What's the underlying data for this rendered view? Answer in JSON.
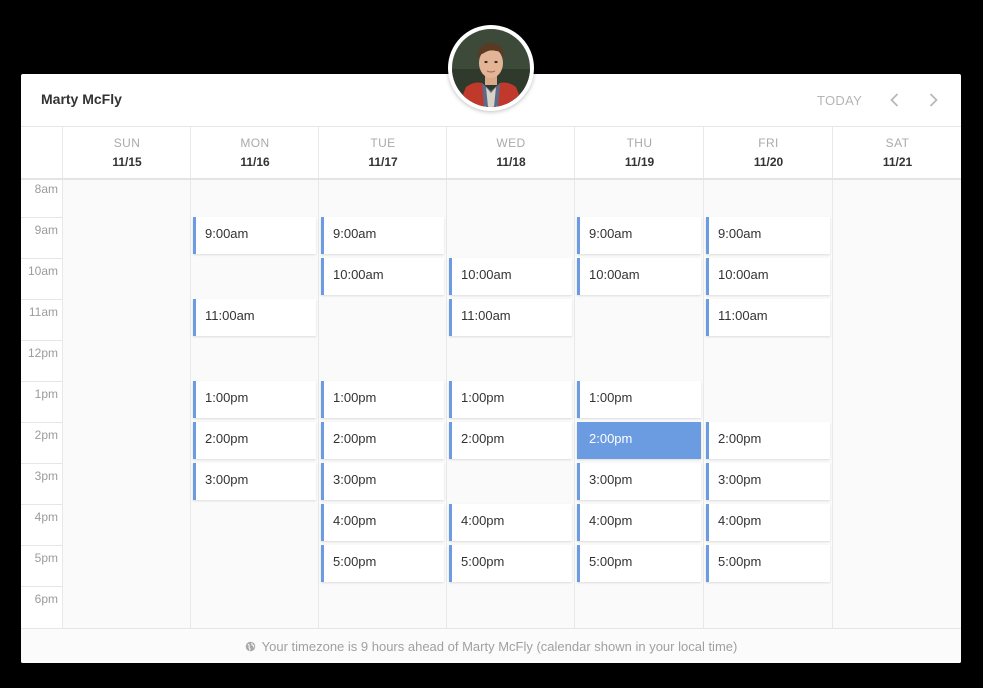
{
  "header": {
    "name": "Marty McFly",
    "today_label": "TODAY",
    "prev_icon": "chevron-left-icon",
    "next_icon": "chevron-right-icon"
  },
  "avatar_icon": "profile-photo",
  "times": [
    "8am",
    "9am",
    "10am",
    "11am",
    "12pm",
    "1pm",
    "2pm",
    "3pm",
    "4pm",
    "5pm",
    "6pm"
  ],
  "days": [
    {
      "name": "SUN",
      "date": "11/15",
      "slots": []
    },
    {
      "name": "MON",
      "date": "11/16",
      "slots": [
        "9:00am",
        "11:00am",
        "1:00pm",
        "2:00pm",
        "3:00pm"
      ]
    },
    {
      "name": "TUE",
      "date": "11/17",
      "slots": [
        "9:00am",
        "10:00am",
        "1:00pm",
        "2:00pm",
        "3:00pm",
        "4:00pm",
        "5:00pm"
      ]
    },
    {
      "name": "WED",
      "date": "11/18",
      "slots": [
        "10:00am",
        "11:00am",
        "1:00pm",
        "2:00pm",
        "4:00pm",
        "5:00pm"
      ]
    },
    {
      "name": "THU",
      "date": "11/19",
      "slots": [
        "9:00am",
        "10:00am",
        "1:00pm",
        "2:00pm",
        "3:00pm",
        "4:00pm",
        "5:00pm"
      ]
    },
    {
      "name": "FRI",
      "date": "11/20",
      "slots": [
        "9:00am",
        "10:00am",
        "11:00am",
        "2:00pm",
        "3:00pm",
        "4:00pm",
        "5:00pm"
      ]
    },
    {
      "name": "SAT",
      "date": "11/21",
      "slots": []
    }
  ],
  "selected": {
    "day": "THU",
    "time": "2:00pm"
  },
  "footer": {
    "text": "Your timezone is 9 hours ahead of Marty McFly (calendar shown in your local time)",
    "icon": "globe-icon"
  },
  "colors": {
    "accent": "#6b9be0",
    "background": "#000000",
    "column": "#fafafa"
  }
}
